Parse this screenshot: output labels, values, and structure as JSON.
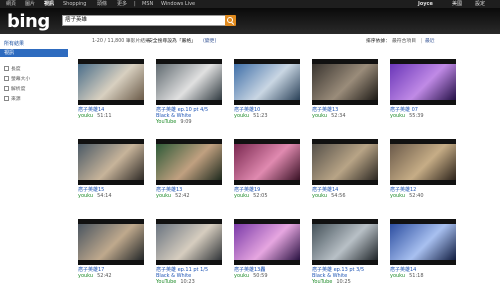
{
  "topnav": {
    "items": [
      "網頁",
      "圖片",
      "視訊",
      "Shopping",
      "頭條",
      "更多",
      "|",
      "MSN",
      "Windows Live"
    ],
    "user": "Joyce",
    "right_links": [
      "美國",
      "設定"
    ]
  },
  "header": {
    "logo": "bing",
    "search_value": "痞子英雄"
  },
  "subbar": {
    "results": "1-20 / 11,800 筆影片結果",
    "safesearch": "安全搜尋設為「嚴格」",
    "safesearch_link": "(變更)",
    "sort_label": "排序依據：",
    "sort_current": "最符合項目",
    "sort_link": "最近"
  },
  "sidebar": {
    "heading": "所有結果",
    "active": "視訊",
    "filters": [
      "長度",
      "螢幕大小",
      "解析度",
      "來源"
    ]
  },
  "videos": [
    {
      "title": "痞子英雄14",
      "title2": "",
      "source": "youku",
      "duration": "51:11",
      "palette": [
        "#4a6e8a",
        "#d8d0c0",
        "#6a5a48"
      ]
    },
    {
      "title": "痞子英雄 ep.10 pt 4/5",
      "title2": "Black & White",
      "source": "YouTube",
      "duration": "9:09",
      "palette": [
        "#606a70",
        "#e0e0e0",
        "#303a40"
      ]
    },
    {
      "title": "痞子英雄10",
      "title2": "",
      "source": "youku",
      "duration": "51:23",
      "palette": [
        "#3f6fa8",
        "#c9d6e3",
        "#2a4158"
      ]
    },
    {
      "title": "痞子英雄13",
      "title2": "",
      "source": "youku",
      "duration": "52:34",
      "palette": [
        "#3a3530",
        "#9a8c7a",
        "#1c1915"
      ]
    },
    {
      "title": "痞子英雄 07",
      "title2": "",
      "source": "youku",
      "duration": "55:39",
      "palette": [
        "#6a36b8",
        "#c08ae6",
        "#241046"
      ]
    },
    {
      "title": "痞子英雄15",
      "title2": "",
      "source": "youku",
      "duration": "54:14",
      "palette": [
        "#4b5a66",
        "#c7b49a",
        "#2e2a26"
      ]
    },
    {
      "title": "痞子英雄13",
      "title2": "",
      "source": "youku",
      "duration": "52:42",
      "palette": [
        "#2e5a38",
        "#c0a080",
        "#1e2a1e"
      ]
    },
    {
      "title": "痞子英雄19",
      "title2": "",
      "source": "youku",
      "duration": "52:05",
      "palette": [
        "#7a2850",
        "#e08ab0",
        "#3a1226"
      ]
    },
    {
      "title": "痞子英雄14",
      "title2": "",
      "source": "youku",
      "duration": "54:56",
      "palette": [
        "#56514a",
        "#b8a486",
        "#2b2722"
      ]
    },
    {
      "title": "痞子英雄12",
      "title2": "",
      "source": "youku",
      "duration": "52:40",
      "palette": [
        "#6b5a4a",
        "#c6ad86",
        "#2c231b"
      ]
    },
    {
      "title": "痞子英雄17",
      "title2": "",
      "source": "youku",
      "duration": "52:42",
      "palette": [
        "#4a5560",
        "#bfa98d",
        "#222628"
      ]
    },
    {
      "title": "痞子英雄 ep.11 pt 1/5",
      "title2": "Black & White",
      "source": "YouTube",
      "duration": "10:23",
      "palette": [
        "#6a7480",
        "#d6cdbf",
        "#303438"
      ]
    },
    {
      "title": "痞子英雄13轟",
      "title2": "",
      "source": "youku",
      "duration": "50:59",
      "palette": [
        "#7a3aa8",
        "#e6a6e0",
        "#2a1242"
      ]
    },
    {
      "title": "痞子英雄 ep.13 pt 3/5",
      "title2": "Black & White",
      "source": "YouTube",
      "duration": "10:25",
      "palette": [
        "#45525a",
        "#b8c0c6",
        "#1e2428"
      ]
    },
    {
      "title": "痞子英雄14",
      "title2": "",
      "source": "youku",
      "duration": "51:18",
      "palette": [
        "#2c4ea0",
        "#a8c0f0",
        "#101c40"
      ]
    }
  ]
}
